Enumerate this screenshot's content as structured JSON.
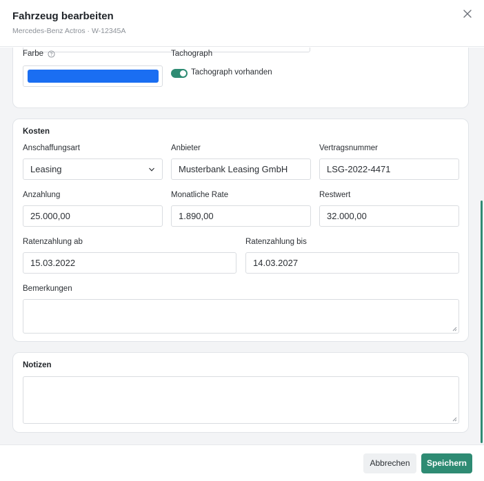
{
  "dialog": {
    "title": "Fahrzeug bearbeiten",
    "subtitle": "Mercedes-Benz Actros · W-12345A",
    "close_icon": "close-icon"
  },
  "colors": {
    "accent": "#2e8b73",
    "swatch": "#1a6ef2",
    "scrollbar": "#2e8b73"
  },
  "appearance": {
    "farbe_label": "Farbe",
    "info_icon": "help-circle-icon",
    "tachograph_label": "Tachograph",
    "tachograph_toggle_label": "Tachograph vorhanden",
    "tachograph_enabled": true
  },
  "kosten": {
    "title": "Kosten",
    "anschaffungsart": {
      "label": "Anschaffungsart",
      "value": "Leasing",
      "icon": "chevron-down-icon"
    },
    "anbieter": {
      "label": "Anbieter",
      "value": "Musterbank Leasing GmbH"
    },
    "vertragsnummer": {
      "label": "Vertragsnummer",
      "value": "LSG-2022-4471"
    },
    "anzahlung": {
      "label": "Anzahlung",
      "value": "25.000,00"
    },
    "monatliche_rate": {
      "label": "Monatliche Rate",
      "value": "1.890,00"
    },
    "restwert": {
      "label": "Restwert",
      "value": "32.000,00"
    },
    "ratenzahlung_ab": {
      "label": "Ratenzahlung ab",
      "value": "15.03.2022"
    },
    "ratenzahlung_bis": {
      "label": "Ratenzahlung bis",
      "value": "14.03.2027"
    },
    "bemerkungen": {
      "label": "Bemerkungen",
      "value": ""
    }
  },
  "notizen": {
    "title": "Notizen",
    "value": ""
  },
  "footer": {
    "cancel_label": "Abbrechen",
    "save_label": "Speichern"
  }
}
